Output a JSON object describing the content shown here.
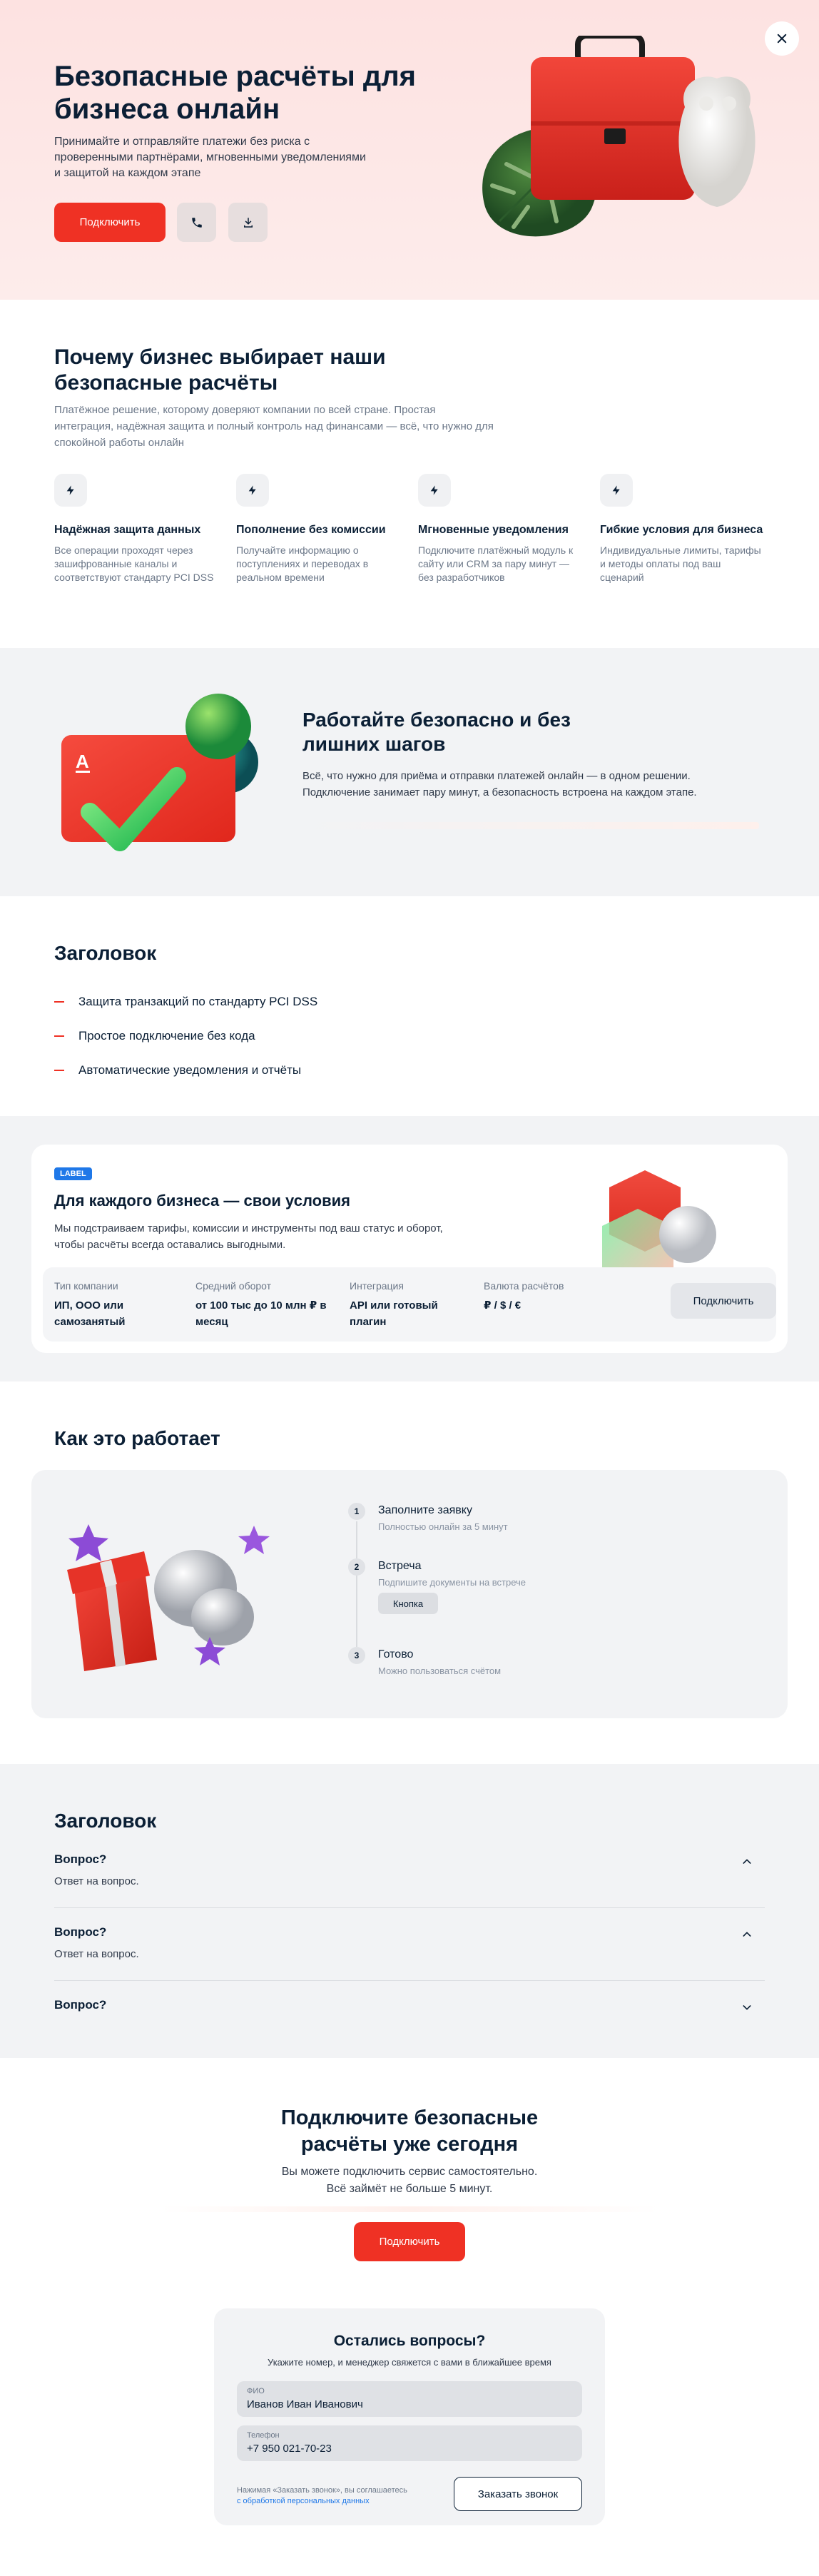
{
  "hero": {
    "title": "Безопасные расчёты для бизнеса онлайн",
    "subtitle": "Принимайте и отправляйте платежи без риска с проверенными партнёрами, мгновенными уведомлениями и защитой на каждом этапе",
    "connect_label": "Подключить",
    "phone_icon": "phone-icon",
    "download_icon": "download-icon",
    "close_icon": "close-icon"
  },
  "why": {
    "title": "Почему бизнес выбирает наши безопасные расчёты",
    "lead": "Платёжное решение, которому доверяют компании по всей стране. Простая интеграция, надёжная защита и полный контроль над финансами — всё, что нужно для спокойной работы онлайн",
    "features": [
      {
        "title": "Надёжная защита данных",
        "text": "Все операции проходят через зашифрованные каналы и соответствуют стандарту PCI DSS",
        "icon": "lightning-icon"
      },
      {
        "title": "Пополнение без комиссии",
        "text": "Получайте информацию о поступлениях и переводах в реальном времени",
        "icon": "lightning-icon"
      },
      {
        "title": "Мгновенные уведомления",
        "text": "Подключите платёжный модуль к сайту или CRM за пару минут — без разработчиков",
        "icon": "lightning-icon"
      },
      {
        "title": "Гибкие условия для бизнеса",
        "text": "Индивидуальные лимиты, тарифы и методы оплаты под ваш сценарий",
        "icon": "lightning-icon"
      }
    ]
  },
  "banner": {
    "title": "Работайте безопасно и без лишних шагов",
    "text": "Всё, что нужно для приёма и отправки платежей онлайн — в одном решении. Подключение занимает пару минут, а безопасность встроена на каждом этапе.",
    "card_letter": "А"
  },
  "list": {
    "title": "Заголовок",
    "items": [
      "Защита транзакций по стандарту PCI DSS",
      "Простое подключение без кода",
      "Автоматические уведомления и отчёты"
    ]
  },
  "product": {
    "badge": "LABEL",
    "title": "Для каждого бизнеса — свои условия",
    "text": "Мы подстраиваем тарифы, комиссии и инструменты под ваш статус и оборот, чтобы расчёты всегда оставались выгодными.",
    "columns": [
      {
        "label": "Тип компании",
        "value": "ИП, ООО или самозанятый"
      },
      {
        "label": "Средний оборот",
        "value": "от 100 тыс до 10 млн ₽ в месяц"
      },
      {
        "label": "Интеграция",
        "value": "API или готовый плагин"
      },
      {
        "label": "Валюта расчётов",
        "value": "₽ / $ / €"
      }
    ],
    "connect_label": "Подключить"
  },
  "how": {
    "title": "Как это работает",
    "steps": [
      {
        "num": "1",
        "title": "Заполните заявку",
        "text": "Полностью онлайн за 5 минут"
      },
      {
        "num": "2",
        "title": "Встреча",
        "text": "Подпишите документы на встрече",
        "button": "Кнопка"
      },
      {
        "num": "3",
        "title": "Готово",
        "text": "Можно пользоваться счётом"
      }
    ]
  },
  "faq": {
    "title": "Заголовок",
    "items": [
      {
        "q": "Вопрос?",
        "a": "Ответ на вопрос.",
        "state": "expanded"
      },
      {
        "q": "Вопрос?",
        "a": "Ответ на вопрос.",
        "state": "expanded"
      },
      {
        "q": "Вопрос?",
        "a": "",
        "state": "collapsed"
      }
    ]
  },
  "cta": {
    "title": "Подключите безопасные расчёты уже сегодня",
    "text_line1": "Вы можете подключить сервис самостоятельно.",
    "text_line2": "Всё займёт не больше 5 минут.",
    "connect_label": "Подключить"
  },
  "form": {
    "title": "Остались вопросы?",
    "subtitle": "Укажите номер, и менеджер свяжется с вами в ближайшее время",
    "name_label": "ФИО",
    "name_value": "Иванов Иван Иванович",
    "phone_label": "Телефон",
    "phone_value": "+7 950 021-70-23",
    "legal_text": "Нажимая «Заказать звонок», вы соглашаетесь",
    "legal_link": "с обработкой персональных данных",
    "submit_label": "Заказать звонок"
  },
  "colors": {
    "accent": "#ef3124",
    "text": "#0b1f35",
    "muted": "#6b7788",
    "surface": "#f2f3f5",
    "hero_bg": "#fde2e1",
    "badge": "#1f78e8"
  }
}
